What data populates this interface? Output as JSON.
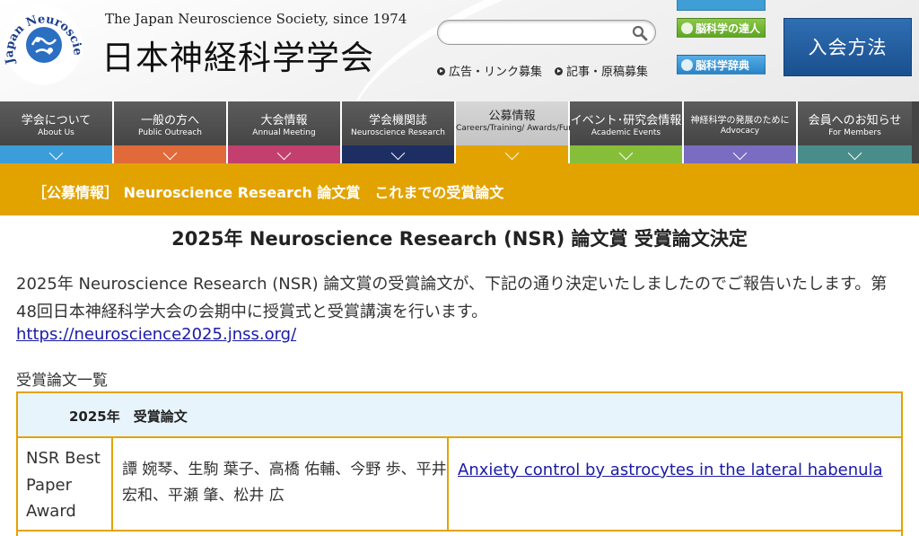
{
  "header": {
    "society_line": "The Japan Neuroscience Society, since 1974",
    "society_name": "日本神経科学学会",
    "logo_ring_text": "Japan Neuroscience Society",
    "search": {
      "placeholder": "",
      "value": ""
    },
    "links": [
      "広告・リンク募集",
      "記事・原稿募集"
    ],
    "side_buttons": {
      "tatsujin": "脳科学の達人",
      "jiten": "脳科学辞典"
    },
    "join_button": "入会方法"
  },
  "nav": [
    {
      "ja": "学会について",
      "en": "About Us",
      "color": "#3b9ed8"
    },
    {
      "ja": "一般の方へ",
      "en": "Public Outreach",
      "color": "#e06a3a"
    },
    {
      "ja": "大会情報",
      "en": "Annual Meeting",
      "color": "#c23f6e"
    },
    {
      "ja": "学会機関誌",
      "en": "Neuroscience Research",
      "color": "#1d2e63"
    },
    {
      "ja": "公募情報",
      "en": "Careers/Training/ Awards/Funding",
      "color": "#e2a300",
      "active": true
    },
    {
      "ja": "イベント･研究会情報",
      "en": "Academic Events",
      "color": "#86be3a"
    },
    {
      "ja": "神経科学の発展のために",
      "en": "Advocacy",
      "color": "#7a6cc0"
    },
    {
      "ja": "会員へのお知らせ",
      "en": "For Members",
      "color": "#4a8c8a"
    }
  ],
  "banner": {
    "text": "［公募情報］ Neuroscience Research 論文賞　これまでの受賞論文"
  },
  "content": {
    "title": "2025年 Neuroscience Research (NSR) 論文賞 受賞論文決定",
    "intro": "2025年 Neuroscience Research (NSR) 論文賞の受賞論文が、下記の通り決定いたしましたのでご報告いたします。第48回日本神経科学大会の会期中に授賞式と受賞講演を行います。",
    "url": "https://neuroscience2025.jnss.org/",
    "section_label": "受賞論文一覧",
    "table": {
      "header": "2025年　受賞論文",
      "rows": [
        {
          "award": "NSR Best Paper Award",
          "authors": "譚 婉琴、生駒 葉子、高橋 佑輔、今野 歩、平井 宏和、平瀬 肇、松井 広",
          "title": "Anxiety control by astrocytes in the lateral habenula"
        }
      ]
    }
  },
  "colors": {
    "accent": "#e2a300",
    "link": "#1a1aa6",
    "join": "#1f5a9c"
  }
}
